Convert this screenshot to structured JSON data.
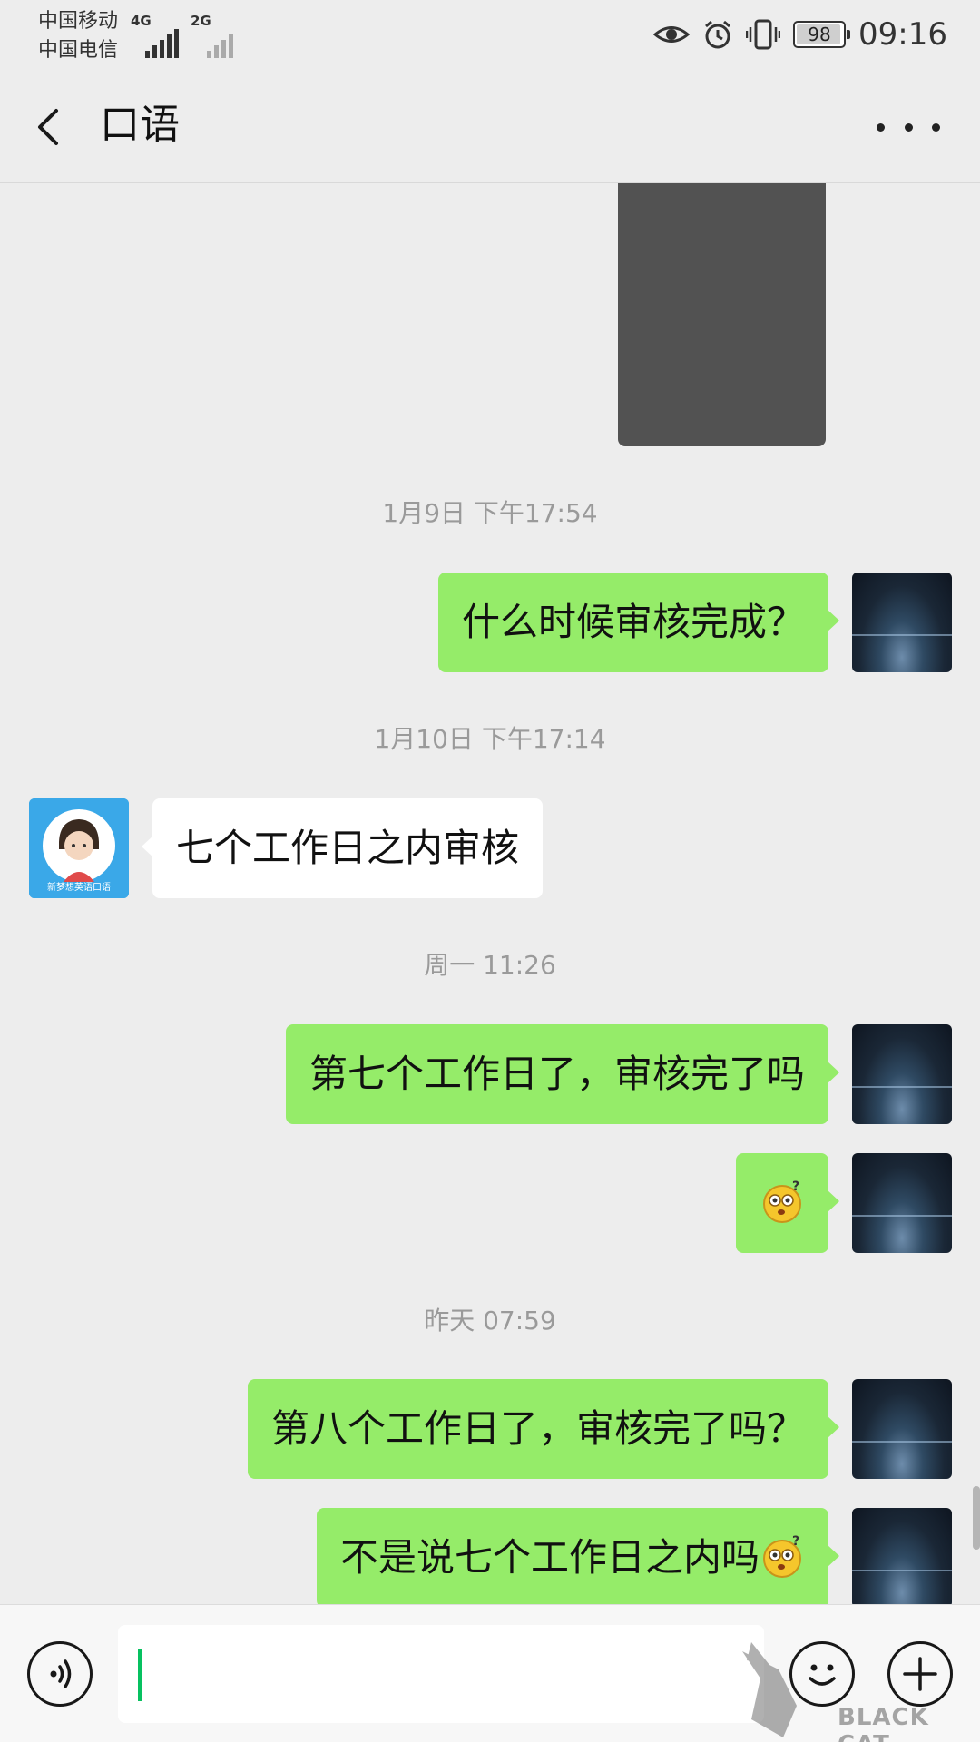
{
  "status_bar": {
    "carrier_1": "中国移动",
    "carrier_2": "中国电信",
    "network_1": "4G",
    "network_2": "2G",
    "battery_level": "98",
    "time": "09:16"
  },
  "header": {
    "title": "口语",
    "back_icon": "chevron-left-icon",
    "more_icon": "more-dots-icon"
  },
  "chat": {
    "timestamps": [
      "1月9日 下午17:54",
      "1月10日 下午17:14",
      "周一 11:26",
      "昨天 07:59"
    ],
    "messages": [
      {
        "side": "out",
        "text": "什么时候审核完成？"
      },
      {
        "side": "in",
        "text": "七个工作日之内审核"
      },
      {
        "side": "out",
        "text": "第七个工作日了，审核完了吗"
      },
      {
        "side": "out",
        "emoji": "confused-emoji"
      },
      {
        "side": "out",
        "text": "第八个工作日了，审核完了吗？"
      },
      {
        "side": "out",
        "text": "不是说七个工作日之内吗",
        "emoji": "confused-emoji"
      }
    ],
    "contact_avatar_text": "新梦想英语口语"
  },
  "input_bar": {
    "value": "",
    "voice_icon": "voice-icon",
    "emoji_icon": "emoji-icon",
    "plus_icon": "plus-icon"
  },
  "watermark": {
    "text": "BLACK CAT"
  },
  "colors": {
    "background": "#ededed",
    "outgoing_bubble": "#95ec69",
    "incoming_bubble": "#ffffff",
    "caret": "#07c160"
  }
}
